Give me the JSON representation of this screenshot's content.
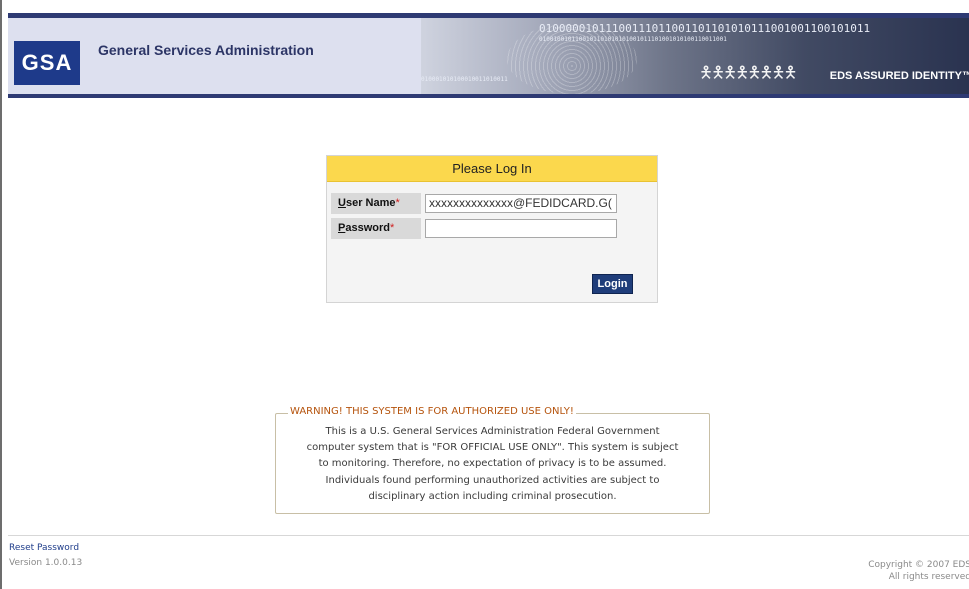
{
  "header": {
    "logo_text": "GSA",
    "agency_name": "General Services Administration",
    "banner_bits_top": "01000001011100111011001101101010111001001100101011",
    "banner_bits_small": "0100100101100101101010101001011101001010100110011001",
    "banner_bits_bottom": "010001010100010011010011",
    "banner_label": "EDS ASSURED IDENTITY™",
    "colors": {
      "navy": "#2e3a73",
      "brand_bg": "#dde0ef"
    }
  },
  "login": {
    "title": "Please Log In",
    "username_label_first": "U",
    "username_label_rest": "ser Name",
    "username_required_mark": "*",
    "username_value": "xxxxxxxxxxxxxx@FEDIDCARD.G(",
    "password_label_first": "P",
    "password_label_rest": "assword",
    "password_required_mark": "*",
    "password_value": "",
    "login_button": "Login",
    "colors": {
      "title_bg": "#fbd84d",
      "button_bg": "#1f3d7a"
    }
  },
  "warning": {
    "title": "WARNING! THIS SYSTEM IS FOR AUTHORIZED USE ONLY!",
    "lines": [
      "This is a U.S. General Services Administration Federal Government",
      "computer system that is \"FOR OFFICIAL USE ONLY\". This system is subject",
      "to monitoring. Therefore, no expectation of privacy is to be assumed.",
      "Individuals found performing unauthorized activities are subject to",
      "disciplinary action including criminal prosecution."
    ]
  },
  "footer": {
    "reset_password": "Reset Password",
    "version": "Version 1.0.0.13",
    "copyright_line1": "Copyright © 2007 EDS",
    "copyright_line2": "All rights reserved"
  }
}
